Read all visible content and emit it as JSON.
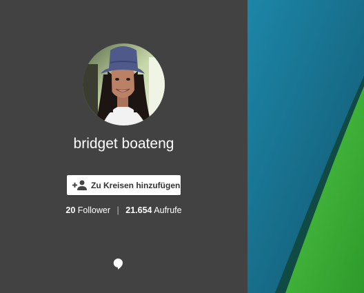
{
  "profile": {
    "name": "bridget boateng",
    "avatar_alt": "profile-photo"
  },
  "actions": {
    "add_to_circles_label": "Zu Kreisen hinzufügen",
    "add_icon": "person-add-icon"
  },
  "stats": {
    "followers_count": "20",
    "followers_label": "Follower",
    "separator": "|",
    "views_count": "21.654",
    "views_label": "Aufrufe"
  },
  "footer": {
    "hangouts_icon": "hangouts-icon"
  },
  "colors": {
    "panel_bg": "#424242",
    "cover_blue": "#1a6f8a",
    "cover_green": "#3fb33a",
    "text": "#ffffff"
  }
}
